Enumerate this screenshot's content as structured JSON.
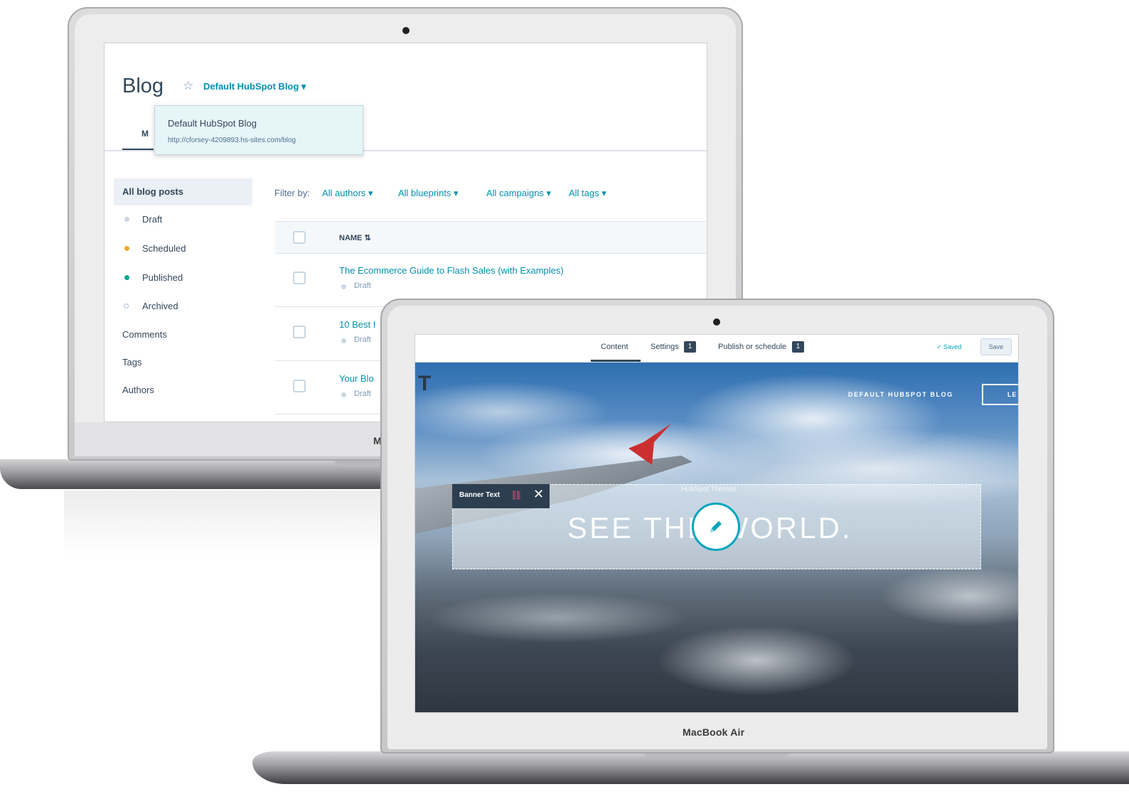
{
  "blog_screen": {
    "title": "Blog",
    "selected_blog": "Default HubSpot Blog ▾",
    "tab_partial": "M",
    "dropdown": {
      "name": "Default HubSpot Blog",
      "url": "http://cforsey-4209893.hs-sites.com/blog"
    },
    "sidebar": {
      "items": [
        {
          "label": "All blog posts"
        },
        {
          "label": "Draft",
          "dot": "#cbd6e2"
        },
        {
          "label": "Scheduled",
          "dot": "#f5a623"
        },
        {
          "label": "Published",
          "dot": "#00a88f"
        },
        {
          "label": "Archived",
          "dot": "hollow"
        },
        {
          "label": "Comments"
        },
        {
          "label": "Tags"
        },
        {
          "label": "Authors"
        }
      ]
    },
    "filters": {
      "label": "Filter by:",
      "items": [
        "All authors ▾",
        "All blueprints ▾",
        "All campaigns ▾",
        "All tags ▾"
      ]
    },
    "table": {
      "column_name": "NAME ⇅",
      "rows": [
        {
          "title": "The Ecommerce Guide to Flash Sales (with Examples)",
          "status": "Draft"
        },
        {
          "title": "10 Best I",
          "status": "Draft"
        },
        {
          "title": "Your Blo",
          "status": "Draft"
        }
      ]
    },
    "laptop_partial_label": "M"
  },
  "editor_screen": {
    "tabs": {
      "content": "Content",
      "settings": "Settings",
      "settings_badge": "1",
      "publish": "Publish or schedule",
      "publish_badge": "1"
    },
    "saved_status": "✓ Saved",
    "save_button": "Save",
    "site": {
      "logo_partial": "T",
      "name": "DEFAULT HUBSPOT BLOG",
      "button_partial": "LE"
    },
    "banner": {
      "toolbar_label": "Banner Text",
      "eyebrow": "HubSpot Themes",
      "headline": "SEE THE WORLD."
    },
    "device_label": "MacBook Air"
  },
  "colors": {
    "accent": "#0091ae",
    "heading": "#33475b",
    "edit_ring": "#00a4bd",
    "wingtip": "#cc2f2f"
  }
}
